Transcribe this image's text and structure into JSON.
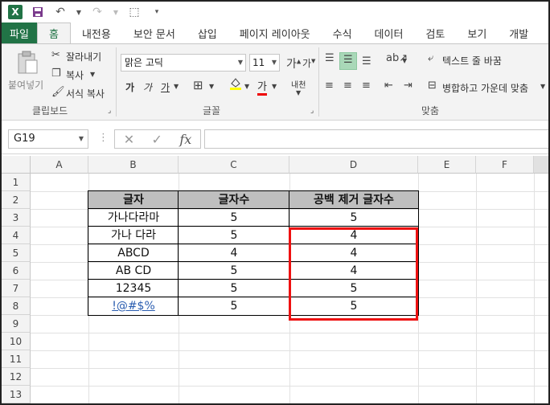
{
  "qat": {
    "logo": "X"
  },
  "tabs": [
    "파일",
    "홈",
    "내전용",
    "보안 문서",
    "삽입",
    "페이지 레이아웃",
    "수식",
    "데이터",
    "검토",
    "보기",
    "개발"
  ],
  "ribbon": {
    "paste": "붙여넣기",
    "cut": "잘라내기",
    "copy": "복사",
    "format_painter": "서식 복사",
    "clipboard_label": "클립보드",
    "font_name": "맑은 고딕",
    "font_size": "11",
    "font_label": "글꼴",
    "bold": "가",
    "italic": "가",
    "underline": "가",
    "font_color": "가",
    "phonetic": "내천",
    "wrap_text": "텍스트 줄 바꿈",
    "merge_center": "병합하고 가운데 맞춤",
    "alignment_label": "맞춤"
  },
  "formula_bar": {
    "name_box": "G19",
    "fx": "fx",
    "formula": ""
  },
  "columns": [
    "A",
    "B",
    "C",
    "D",
    "E",
    "F"
  ],
  "rows": [
    "1",
    "2",
    "3",
    "4",
    "5",
    "6",
    "7",
    "8",
    "9",
    "10",
    "11",
    "12",
    "13"
  ],
  "table": {
    "headers": [
      "글자",
      "글자수",
      "공백 제거 글자수"
    ],
    "rows": [
      [
        "가나다라마",
        "5",
        "5"
      ],
      [
        "가나 다라",
        "5",
        "4"
      ],
      [
        "ABCD",
        "4",
        "4"
      ],
      [
        "AB CD",
        "5",
        "4"
      ],
      [
        "12345",
        "5",
        "5"
      ],
      [
        "!@#$%",
        "5",
        "5"
      ]
    ]
  },
  "colors": {
    "accent": "#217346",
    "highlight": "#ee1111",
    "header_fill": "#bfbfbf"
  }
}
